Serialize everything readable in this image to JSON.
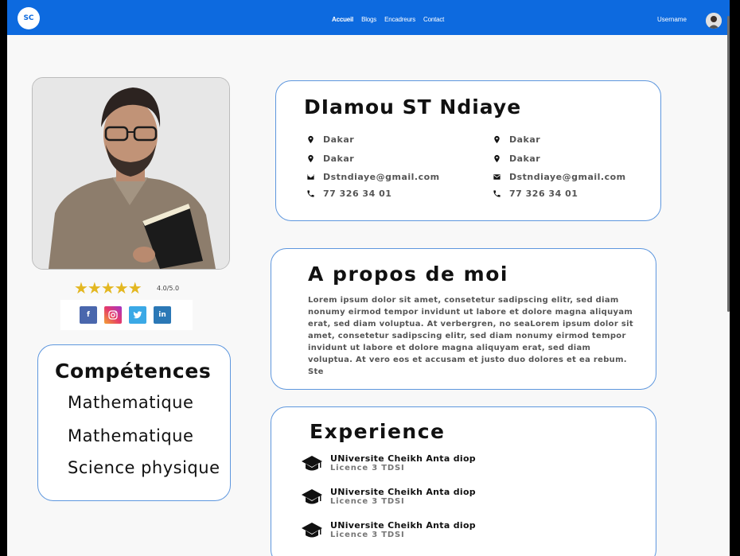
{
  "navbar": {
    "logo": "SC",
    "links": [
      "Accueil",
      "Blogs",
      "Encadreurs",
      "Contact"
    ],
    "active_link": "Accueil",
    "username": "Username"
  },
  "profile": {
    "rating_text": "4.0/5.0",
    "stars": "★★★★★",
    "rating_value": 4.0,
    "social": [
      "f",
      "ig",
      "t",
      "in"
    ]
  },
  "skills": {
    "title": "Compétences",
    "items": [
      "Mathematique",
      "Mathematique",
      "Science physique"
    ]
  },
  "info": {
    "name": "DIamou ST Ndiaye",
    "left": {
      "city1": "Dakar",
      "city2": "Dakar",
      "email": "Dstndiaye@gmail.com",
      "phone": "77 326 34 01"
    },
    "right": {
      "city1": "Dakar",
      "city2": "Dakar",
      "email": "Dstndiaye@gmail.com",
      "phone": "77 326 34 01"
    }
  },
  "about": {
    "title": "A propos de moi",
    "text": "Lorem ipsum dolor sit amet, consetetur sadipscing elitr, sed diam nonumy eirmod tempor invidunt ut labore et dolore magna aliquyam erat, sed diam voluptua. At verbergren, no seaLorem ipsum dolor sit amet, consetetur sadipscing elitr, sed diam nonumy eirmod tempor invidunt ut labore et dolore magna aliquyam erat, sed diam voluptua. At vero eos et accusam et justo duo dolores et ea rebum. Ste"
  },
  "experience": {
    "title": "Experience",
    "items": [
      {
        "school": "UNiversite Cheikh Anta diop",
        "degree": "Licence 3 TDSI"
      },
      {
        "school": "UNiversite Cheikh Anta diop",
        "degree": "Licence 3 TDSI"
      },
      {
        "school": "UNiversite Cheikh Anta diop",
        "degree": "Licence 3 TDSI"
      }
    ]
  },
  "colors": {
    "primary": "#0d6adf",
    "card_border": "#5e97de",
    "star": "#e3b721"
  }
}
